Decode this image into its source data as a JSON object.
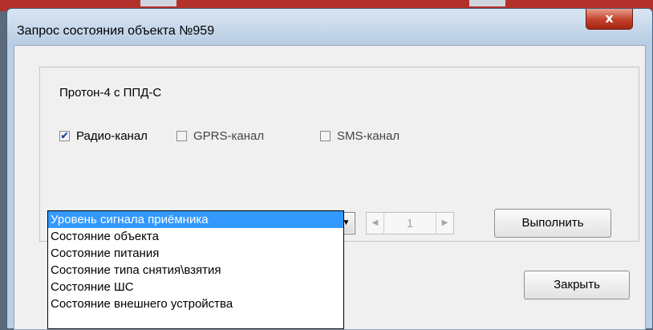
{
  "window": {
    "title": "Запрос состояния объекта №959",
    "close_glyph": "x"
  },
  "device": {
    "label": "Протон-4 с ППД-С"
  },
  "channels": [
    {
      "label": "Радио-канал",
      "checked": true
    },
    {
      "label": "GPRS-канал",
      "checked": false
    },
    {
      "label": "SMS-канал",
      "checked": false
    }
  ],
  "request_combo": {
    "value": "",
    "options": [
      "Уровень сигнала приёмника",
      "Состояние объекта",
      "Состояние питания",
      "Состояние типа снятия\\взятия",
      "Состояние ШС",
      "Состояние внешнего устройства"
    ],
    "highlighted_index": 0
  },
  "spinner": {
    "value": "1"
  },
  "buttons": {
    "execute": "Выполнить",
    "close": "Закрыть"
  },
  "icons": {
    "check": "checkmark-icon",
    "combo_arrow": "chevron-down-icon",
    "spinner_left": "chevron-left-icon",
    "spinner_right": "chevron-right-icon",
    "close": "close-icon"
  }
}
